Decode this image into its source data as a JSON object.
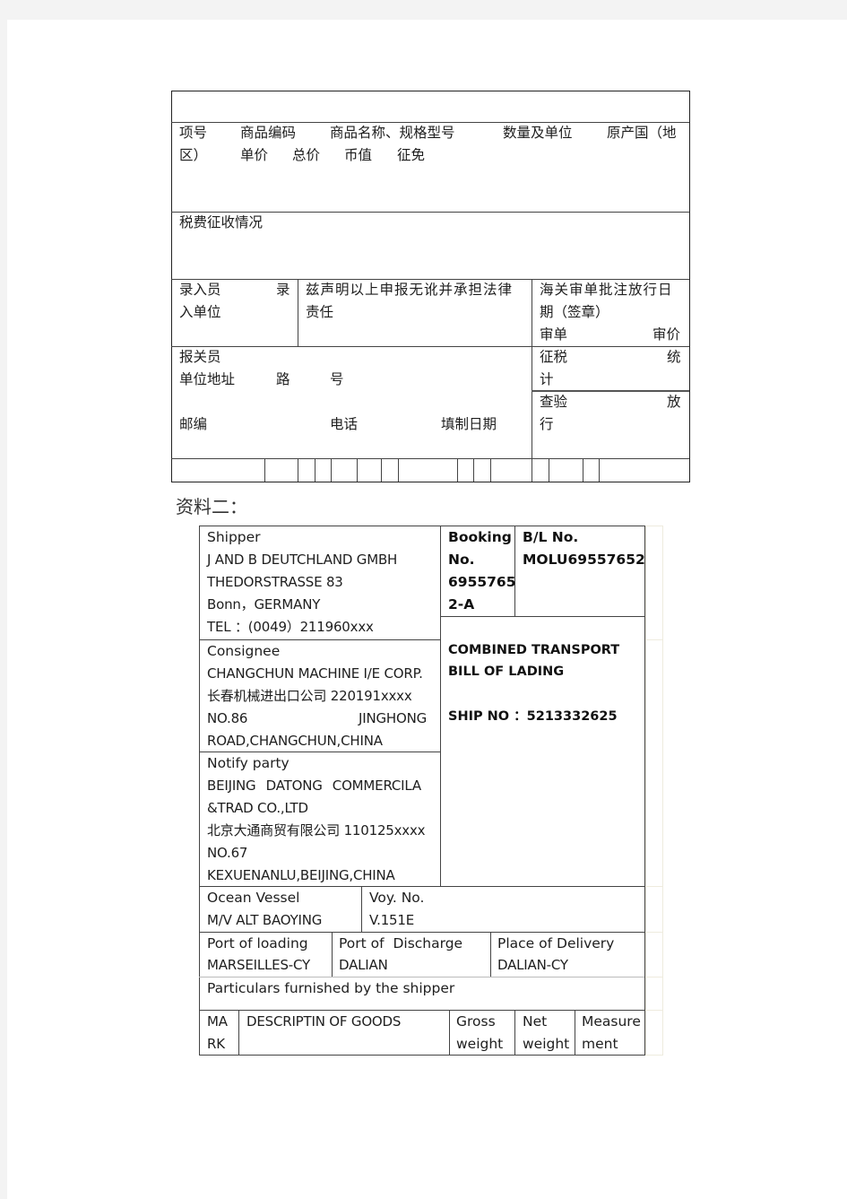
{
  "customs_form": {
    "items_header_line1": [
      "项号",
      "商品编码",
      "商品名称、规格型号",
      "数量及单位",
      "原产国（地"
    ],
    "items_header_line2": [
      "区）",
      "单价",
      "总价",
      "币值",
      "征免"
    ],
    "tax_section": "税费征收情况",
    "entry_clerk": "录入员",
    "entry_unit_part1": "录",
    "entry_unit_part2": "入单位",
    "declaration_line1": "兹声明以上申报无讹并承担法律",
    "declaration_line2": "责任",
    "customs_approval_line1": "海关审单批注放行日",
    "customs_approval_line2": "期（签章）",
    "review_doc": "审单",
    "review_price": "审价",
    "declarant": "报关员",
    "unit_address": "单位地址",
    "road": "路",
    "number": "号",
    "postcode": "邮编",
    "phone": "电话",
    "fill_date": "填制日期",
    "tax_levy": "征税",
    "statistics_part1": "统",
    "statistics_part2": "计",
    "inspection": "查验",
    "release_part1": "放",
    "release_part2": "行"
  },
  "section_heading": "资料二：",
  "bill_of_lading": {
    "shipper": {
      "label": "Shipper",
      "lines": [
        "J AND B DEUTCHLAND GMBH",
        "THEDORSTRASSE 83",
        "Bonn，GERMANY",
        "TEL ：(0049）211960xxx"
      ]
    },
    "booking": {
      "label_line1": "Booking",
      "label_line2": "No.",
      "value_line1": "6955765",
      "value_line2": "2-A"
    },
    "bl_no": {
      "label": "B/L No.",
      "value": "MOLU69557652"
    },
    "title_line1": "COMBINED TRANSPORT",
    "title_line2": "BILL OF LADING",
    "ship_no": "SHIP NO ：5213332625",
    "consignee": {
      "label": "Consignee",
      "line1": "CHANGCHUN MACHINE I/E CORP.",
      "line2": "长春机械进出口公司 220191xxxx",
      "line3_left": "NO.86",
      "line3_right": "JINGHONG",
      "line4": "ROAD,CHANGCHUN,CHINA"
    },
    "notify_party": {
      "label": "Notify party",
      "line1_words": [
        "BEIJING",
        "DATONG",
        "COMMERCILA"
      ],
      "line2": "&TRAD CO.,LTD",
      "line3": "北京大通商贸有限公司 110125xxxx",
      "line4": "NO.67",
      "line5": "KEXUENANLU,BEIJING,CHINA"
    },
    "ocean_vessel": {
      "label": "Ocean Vessel",
      "value": "M/V ALT BAOYING"
    },
    "voyage": {
      "label": "Voy. No.",
      "value": "V.151E"
    },
    "port_of_loading": {
      "label": "Port of loading",
      "value": "MARSEILLES-CY"
    },
    "port_of_discharge": {
      "label": "Port of  Discharge",
      "value": "DALIAN"
    },
    "place_of_delivery": {
      "label": "Place of Delivery",
      "value": "DALIAN-CY"
    },
    "particulars": "Particulars furnished by the shipper",
    "goods_headers": {
      "mark_line1": "MA",
      "mark_line2": "RK",
      "description": "DESCRIPTIN OF GOODS",
      "gross_line1": "Gross",
      "gross_line2": "weight",
      "net_line1": "Net",
      "net_line2": "weight",
      "measure_line1": "Measure",
      "measure_line2": "ment"
    }
  }
}
